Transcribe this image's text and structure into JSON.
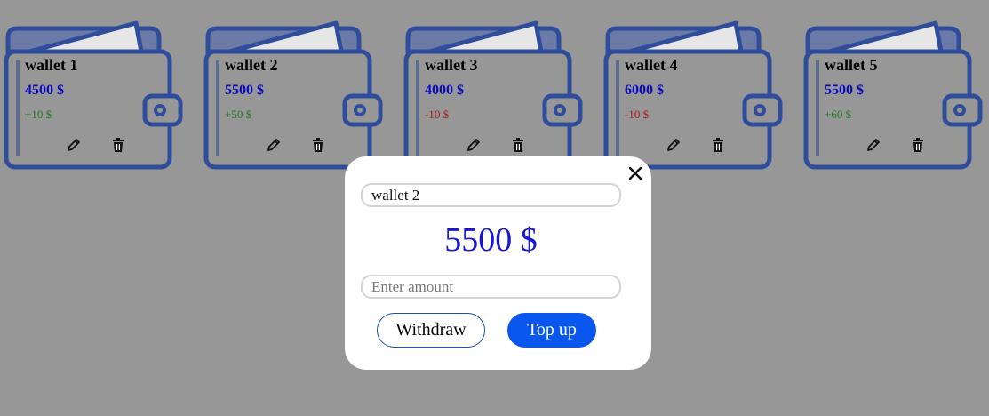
{
  "colors": {
    "background": "#979797",
    "wallet_outline": "#2f4d9a",
    "wallet_amount": "#0b0bbd",
    "positive_change": "#1f7a1f",
    "negative_change": "#b01717",
    "modal_amount": "#1616d6",
    "primary_button": "#0a57f0"
  },
  "wallets": [
    {
      "name": "wallet 1",
      "amount": "4500 $",
      "change": "+10 $",
      "change_sign": "positive",
      "edit_icon": "pencil-icon",
      "delete_icon": "trash-icon"
    },
    {
      "name": "wallet 2",
      "amount": "5500 $",
      "change": "+50 $",
      "change_sign": "positive",
      "edit_icon": "pencil-icon",
      "delete_icon": "trash-icon"
    },
    {
      "name": "wallet 3",
      "amount": "4000 $",
      "change": "-10 $",
      "change_sign": "negative",
      "edit_icon": "pencil-icon",
      "delete_icon": "trash-icon"
    },
    {
      "name": "wallet 4",
      "amount": "6000 $",
      "change": "-10 $",
      "change_sign": "negative",
      "edit_icon": "pencil-icon",
      "delete_icon": "trash-icon"
    },
    {
      "name": "wallet 5",
      "amount": "5500 $",
      "change": "+60 $",
      "change_sign": "positive",
      "edit_icon": "pencil-icon",
      "delete_icon": "trash-icon"
    }
  ],
  "modal": {
    "close_icon": "close-icon",
    "name_value": "wallet 2",
    "amount_display": "5500 $",
    "amount_placeholder": "Enter amount",
    "amount_value": "",
    "withdraw_label": "Withdraw",
    "topup_label": "Top up"
  }
}
